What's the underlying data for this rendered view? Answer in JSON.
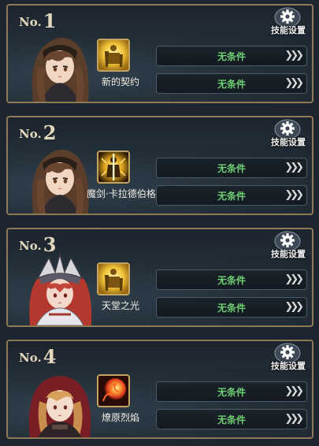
{
  "gear_label": "技能设置",
  "no_prefix": "No.",
  "teams": [
    {
      "number": "1",
      "skill_name": "新的契约",
      "conditions": [
        "无条件",
        "无条件"
      ],
      "skill_icon": "golden-knight-icon",
      "portrait": "brown-haired-girl-portrait"
    },
    {
      "number": "2",
      "skill_name": "魔剑·卡拉德伯格",
      "conditions": [
        "无条件",
        "无条件"
      ],
      "skill_icon": "glowing-sword-knight-icon",
      "portrait": "brown-haired-girl-portrait"
    },
    {
      "number": "3",
      "skill_name": "天堂之光",
      "conditions": [
        "无条件",
        "无条件"
      ],
      "skill_icon": "golden-knight-icon",
      "portrait": "red-haired-armored-girl-portrait"
    },
    {
      "number": "4",
      "skill_name": "燎原烈焰",
      "conditions": [
        "无条件",
        "无条件"
      ],
      "skill_icon": "fireball-icon",
      "portrait": "red-hooded-girl-portrait"
    }
  ],
  "colors": {
    "frame_gold": "#8e7a55",
    "condition_green": "#6fcf73",
    "panel_bg": "#1d2731"
  }
}
